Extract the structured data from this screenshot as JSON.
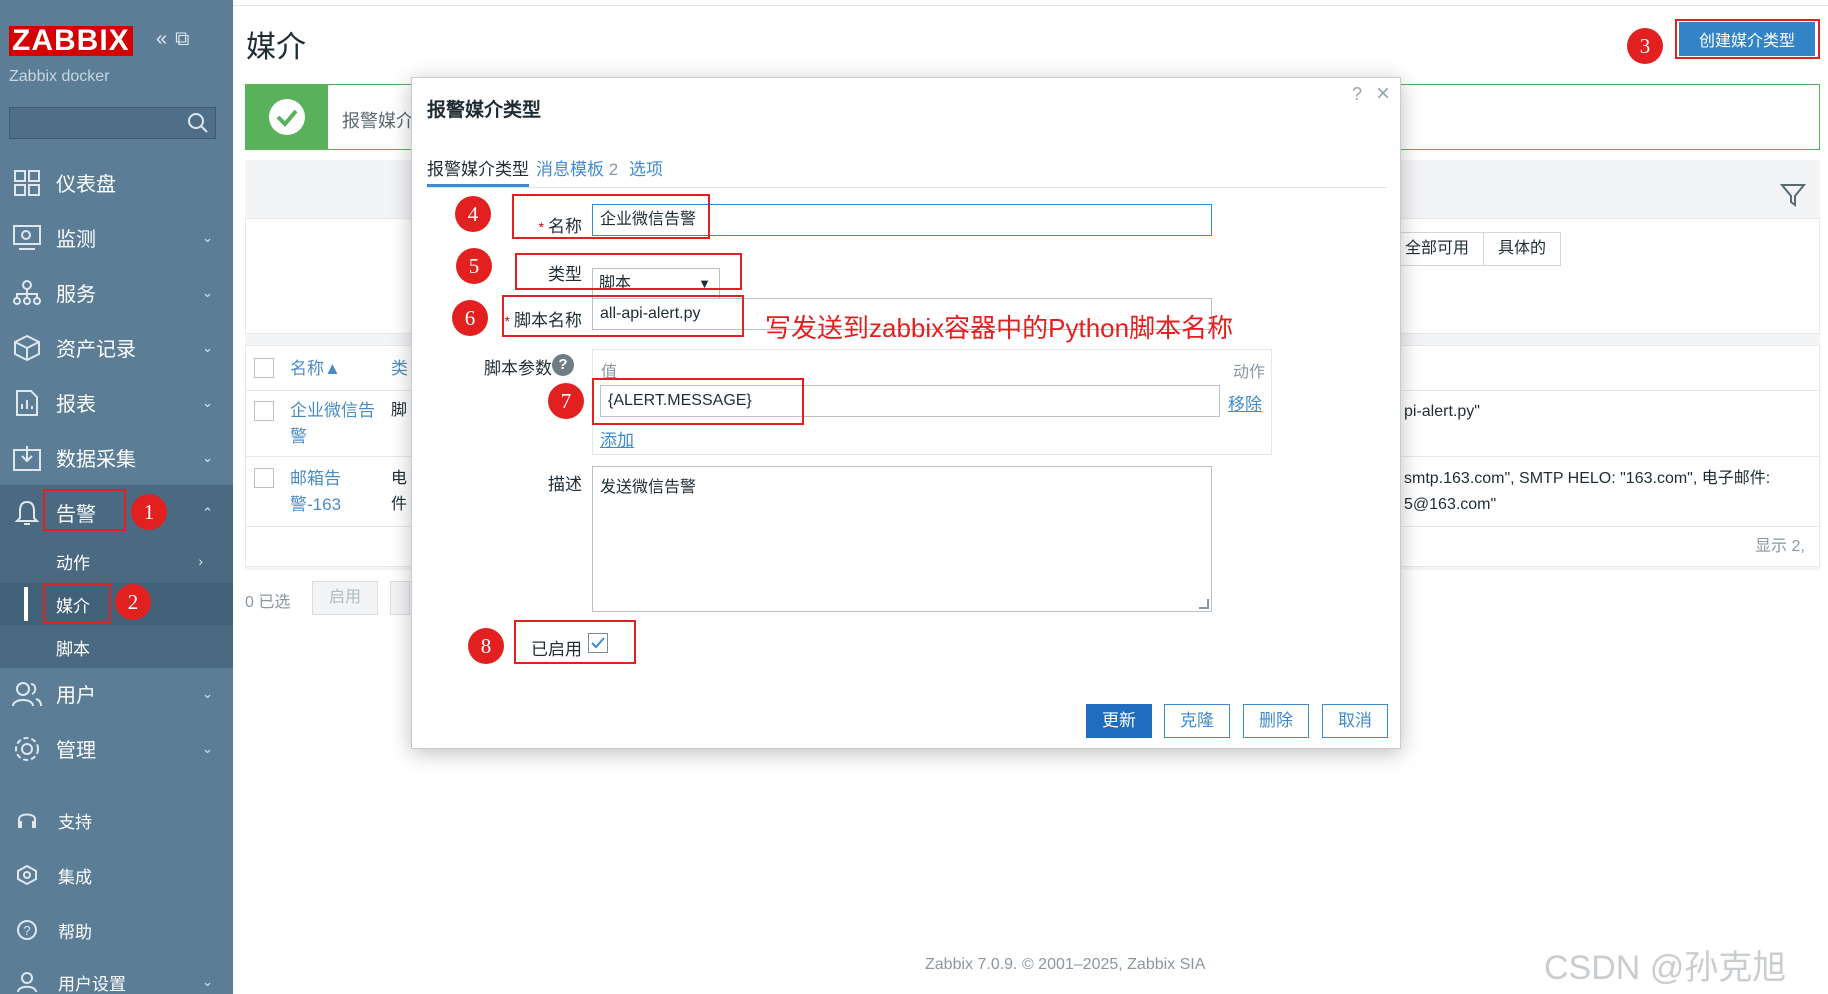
{
  "app": {
    "logo": "ZABBIX",
    "server_name": "Zabbix docker",
    "page_title": "媒介",
    "create_button": "创建媒介类型",
    "copyright": "Zabbix 7.0.9. © 2001–2025, Zabbix SIA",
    "watermark": "CSDN @孙克旭"
  },
  "sidebar": {
    "search_placeholder": "",
    "items": [
      {
        "label": "仪表盘",
        "icon": "dashboard-icon"
      },
      {
        "label": "监测",
        "icon": "monitoring-icon"
      },
      {
        "label": "服务",
        "icon": "services-icon"
      },
      {
        "label": "资产记录",
        "icon": "inventory-icon"
      },
      {
        "label": "报表",
        "icon": "reports-icon"
      },
      {
        "label": "数据采集",
        "icon": "data-collection-icon"
      },
      {
        "label": "告警",
        "icon": "bell-icon"
      },
      {
        "label": "用户",
        "icon": "users-icon"
      },
      {
        "label": "管理",
        "icon": "gear-icon"
      }
    ],
    "alerts_sub": [
      "动作",
      "媒介",
      "脚本"
    ],
    "bottom": [
      {
        "label": "支持",
        "icon": "headset-icon"
      },
      {
        "label": "集成",
        "icon": "integrations-icon"
      },
      {
        "label": "帮助",
        "icon": "help-icon"
      },
      {
        "label": "用户设置",
        "icon": "user-settings-icon"
      }
    ]
  },
  "message": {
    "text": "报警媒介"
  },
  "filter": {
    "seg_all": "全部可用",
    "seg_specific": "具体的"
  },
  "table": {
    "col_name": "名称▲",
    "col_type": "类",
    "rows": [
      {
        "name_line1": "企业微信告",
        "name_line2": "警",
        "type": "脚",
        "detail": "pi-alert.py\""
      },
      {
        "name_line1": "邮箱告",
        "name_line2": "警-163",
        "type_line1": "电",
        "type_line2": "件",
        "detail_line1": "smtp.163.com\", SMTP HELO: \"163.com\", 电子邮件:",
        "detail_line2": "5@163.com\""
      }
    ],
    "shown": "显示 2,"
  },
  "footer": {
    "selected": "0 已选",
    "enable": "启用"
  },
  "modal": {
    "title": "报警媒介类型",
    "help": "?",
    "tabs": {
      "media_type": "报警媒介类型",
      "templates": "消息模板",
      "templates_count": "2",
      "options": "选项"
    },
    "name_label": "名称",
    "name_value": "企业微信告警",
    "type_label": "类型",
    "type_value": "脚本",
    "script_name_label": "脚本名称",
    "script_name_value": "all-api-alert.py",
    "script_params_label": "脚本参数",
    "params_header_value": "值",
    "params_header_action": "动作",
    "param_value": "{ALERT.MESSAGE}",
    "remove_link": "移除",
    "add_link": "添加",
    "description_label": "描述",
    "description_value": "发送微信告警",
    "enabled_label": "已启用",
    "buttons": {
      "update": "更新",
      "clone": "克隆",
      "delete": "删除",
      "cancel": "取消"
    }
  },
  "annotations": {
    "badges": [
      "1",
      "2",
      "3",
      "4",
      "5",
      "6",
      "7",
      "8"
    ],
    "note": "写发送到zabbix容器中的Python脚本名称"
  }
}
